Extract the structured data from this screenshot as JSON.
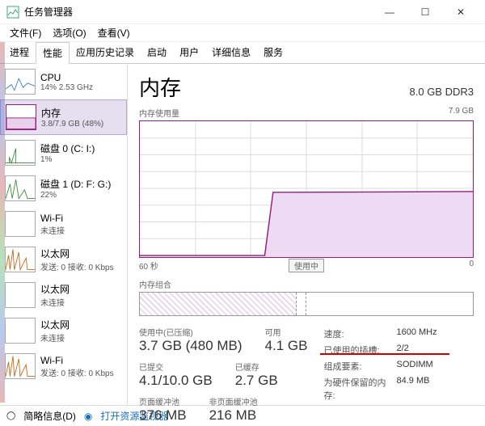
{
  "window": {
    "title": "任务管理器"
  },
  "menu": {
    "file": "文件(F)",
    "options": "选项(O)",
    "view": "查看(V)"
  },
  "tabs": [
    {
      "id": "processes",
      "label": "进程"
    },
    {
      "id": "performance",
      "label": "性能"
    },
    {
      "id": "history",
      "label": "应用历史记录"
    },
    {
      "id": "startup",
      "label": "启动"
    },
    {
      "id": "users",
      "label": "用户"
    },
    {
      "id": "details",
      "label": "详细信息"
    },
    {
      "id": "services",
      "label": "服务"
    }
  ],
  "sidebar": [
    {
      "name": "CPU",
      "sub": "14% 2.53 GHz",
      "color": "#3b82c4"
    },
    {
      "name": "内存",
      "sub": "3.8/7.9 GB (48%)",
      "color": "#951b81",
      "selected": true
    },
    {
      "name": "磁盘 0 (C: I:)",
      "sub": "1%",
      "color": "#3a8f3a"
    },
    {
      "name": "磁盘 1 (D: F: G:)",
      "sub": "22%",
      "color": "#3a8f3a"
    },
    {
      "name": "Wi-Fi",
      "sub": "未连接",
      "color": "#999"
    },
    {
      "name": "以太网",
      "sub": "发送: 0 接收: 0 Kbps",
      "color": "#c46a1c"
    },
    {
      "name": "以太网",
      "sub": "未连接",
      "color": "#999"
    },
    {
      "name": "以太网",
      "sub": "未连接",
      "color": "#999"
    },
    {
      "name": "Wi-Fi",
      "sub": "发送: 0 接收: 0 Kbps",
      "color": "#c46a1c"
    }
  ],
  "header": {
    "title": "内存",
    "spec": "8.0 GB DDR3"
  },
  "chart": {
    "label": "内存使用量",
    "max_label": "7.9 GB",
    "x_left": "60 秒",
    "x_right": "0",
    "mid_button": "使用中"
  },
  "composition": {
    "label": "内存组合"
  },
  "stats": {
    "in_use_label": "使用中(已压缩)",
    "in_use_value": "3.7 GB (480 MB)",
    "avail_label": "可用",
    "avail_value": "4.1 GB",
    "committed_label": "已提交",
    "committed_value": "4.1/10.0 GB",
    "cached_label": "已缓存",
    "cached_value": "2.7 GB",
    "paged_label": "页面缓冲池",
    "paged_value": "376 MB",
    "nonpaged_label": "非页面缓冲池",
    "nonpaged_value": "216 MB"
  },
  "kv": {
    "speed_k": "速度:",
    "speed_v": "1600 MHz",
    "slots_k": "已使用的插槽:",
    "slots_v": "2/2",
    "form_k": "组成要素:",
    "form_v": "SODIMM",
    "hw_k": "为硬件保留的内存:",
    "hw_v": "84.9 MB"
  },
  "footer": {
    "fewer": "简略信息(D)",
    "resmon": "打开资源监视器"
  },
  "chart_data": {
    "type": "area",
    "title": "内存使用量",
    "ylabel": "GB",
    "ylim": [
      0,
      7.9
    ],
    "xlabel": "秒",
    "xlim_label": [
      "60 秒",
      "0"
    ],
    "x": [
      0,
      5,
      10,
      15,
      20,
      25,
      30,
      35,
      40,
      45,
      50,
      55,
      60
    ],
    "values": [
      0.1,
      0.1,
      0.1,
      0.1,
      0.1,
      3.8,
      3.8,
      3.8,
      3.8,
      3.8,
      3.8,
      3.8,
      3.8
    ]
  }
}
